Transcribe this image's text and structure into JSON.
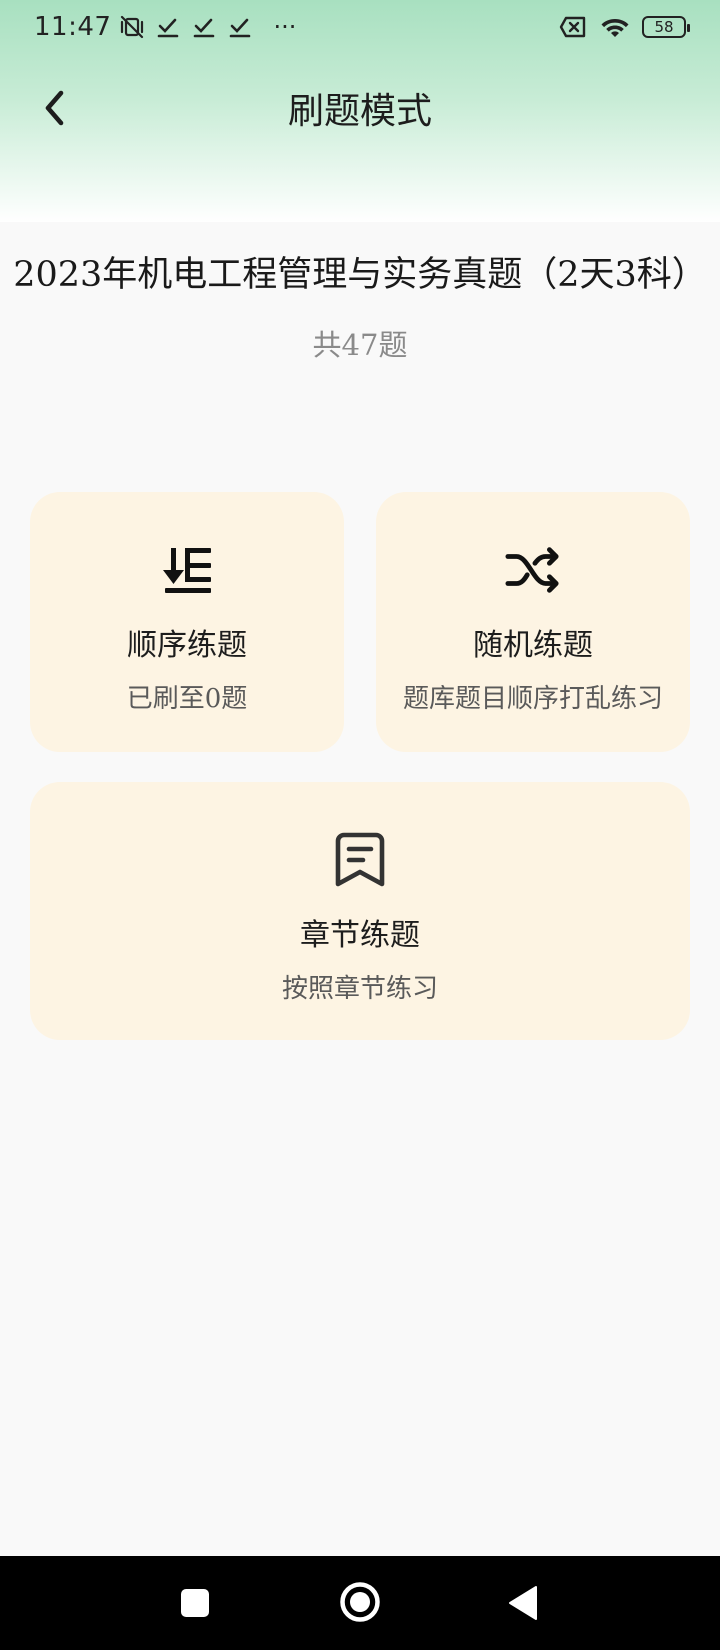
{
  "status_bar": {
    "time": "11:47",
    "overflow": "···",
    "battery_level": "58",
    "icons": [
      "vibrate-off-icon",
      "download-done-icon",
      "download-done-icon",
      "download-done-icon",
      "sim-off-icon",
      "wifi-icon",
      "battery-icon"
    ]
  },
  "app_bar": {
    "title": "刷题模式",
    "back_icon": "chevron-left-icon"
  },
  "exam": {
    "title": "2023年机电工程管理与实务真题（2天3科）",
    "count": "共47题"
  },
  "modes": {
    "sequential": {
      "icon": "sort-down-list-icon",
      "title": "顺序练题",
      "subtitle": "已刷至0题"
    },
    "random": {
      "icon": "shuffle-icon",
      "title": "随机练题",
      "subtitle": "题库题目顺序打乱练习"
    },
    "chapter": {
      "icon": "document-bookmark-icon",
      "title": "章节练题",
      "subtitle": "按照章节练习"
    }
  },
  "colors": {
    "header_gradient_top": "#a8e0c0",
    "card_background": "#fdf4e3",
    "page_background": "#f9f9f9",
    "nav_bar": "#000000"
  },
  "nav_bar": {
    "icons": [
      "recent-apps-icon",
      "home-icon",
      "back-icon"
    ]
  }
}
